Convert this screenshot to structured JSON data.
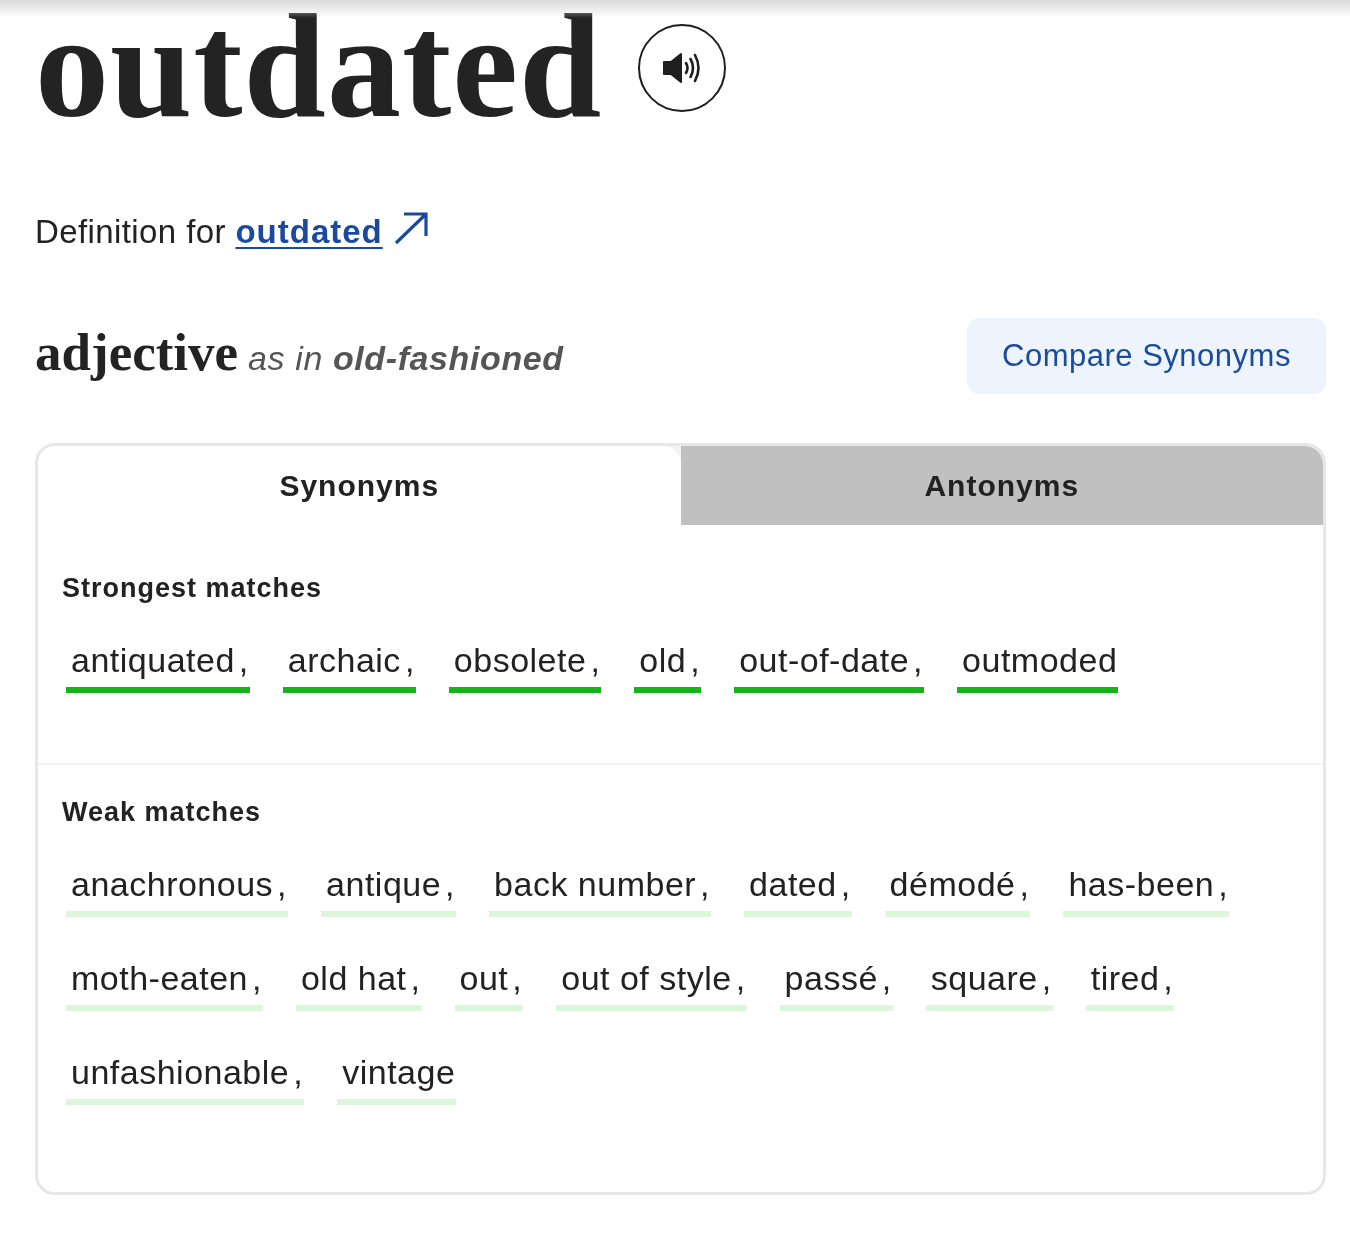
{
  "headword": {
    "text": "outdated"
  },
  "definition_line": {
    "prefix": "Definition for",
    "link": "outdated"
  },
  "sense": {
    "part_of_speech": "adjective",
    "phrase": "as in **old-fashioned**"
  },
  "compare_button": {
    "label": "Compare Synonyms"
  },
  "tabs": [
    {
      "label": "Synonyms",
      "selected": true
    },
    {
      "label": "Antonyms",
      "selected": false
    }
  ],
  "groups": [
    {
      "label": "Strongest matches",
      "strong": true,
      "words": [
        {
          "word": "antiquated",
          "separator": ","
        },
        {
          "word": "archaic",
          "separator": ","
        },
        {
          "word": "obsolete",
          "separator": ","
        },
        {
          "word": "old",
          "separator": ","
        },
        {
          "word": "out-of-date",
          "separator": ","
        },
        {
          "word": "outmoded"
        }
      ]
    },
    {
      "label": "Weak matches",
      "strong": false,
      "words": [
        {
          "word": "anachronous",
          "separator": ","
        },
        {
          "word": "antique",
          "separator": ","
        },
        {
          "word": "back number",
          "separator": ","
        },
        {
          "word": "dated",
          "separator": ","
        },
        {
          "word": "démodé",
          "separator": ","
        },
        {
          "word": "has-been",
          "separator": ","
        },
        {
          "word": "moth-eaten",
          "separator": ","
        },
        {
          "word": "old hat",
          "separator": ","
        },
        {
          "word": "out",
          "separator": ","
        },
        {
          "word": "out of style",
          "separator": ","
        },
        {
          "word": "passé",
          "separator": ","
        },
        {
          "word": "square",
          "separator": ","
        },
        {
          "word": "tired",
          "separator": ","
        },
        {
          "word": "unfashionable",
          "separator": ","
        },
        {
          "word": "vintage"
        }
      ]
    }
  ]
}
